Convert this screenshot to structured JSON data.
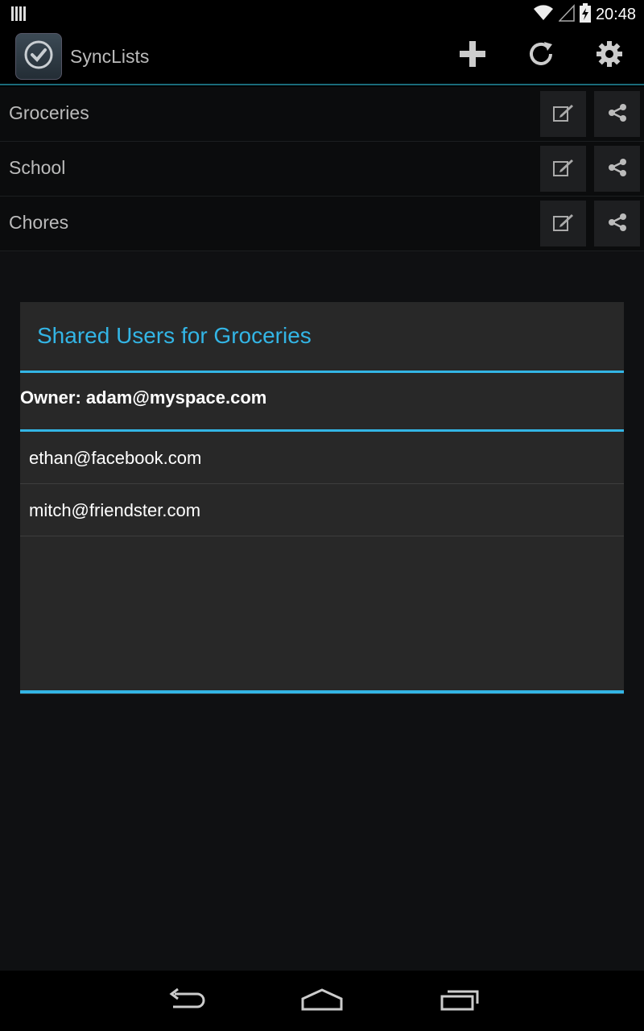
{
  "status_bar": {
    "time": "20:48",
    "icons": [
      "notification-bars-icon",
      "wifi-icon",
      "cell-signal-icon",
      "battery-charging-icon"
    ]
  },
  "action_bar": {
    "app_title": "SyncLists",
    "app_icon": "checkmark-icon",
    "actions": [
      "add-icon",
      "refresh-icon",
      "settings-icon"
    ]
  },
  "lists": [
    {
      "label": "Groceries"
    },
    {
      "label": "School"
    },
    {
      "label": "Chores"
    }
  ],
  "dialog": {
    "title": "Shared Users for Groceries",
    "owner": "Owner: adam@myspace.com",
    "users": [
      {
        "email": "ethan@facebook.com"
      },
      {
        "email": "mitch@friendster.com"
      }
    ]
  },
  "nav_bar": {
    "icons": [
      "back-icon",
      "home-icon",
      "recents-icon"
    ]
  },
  "colors": {
    "accent": "#33b5e5",
    "background": "#000000",
    "dialog_bg": "#282828"
  }
}
